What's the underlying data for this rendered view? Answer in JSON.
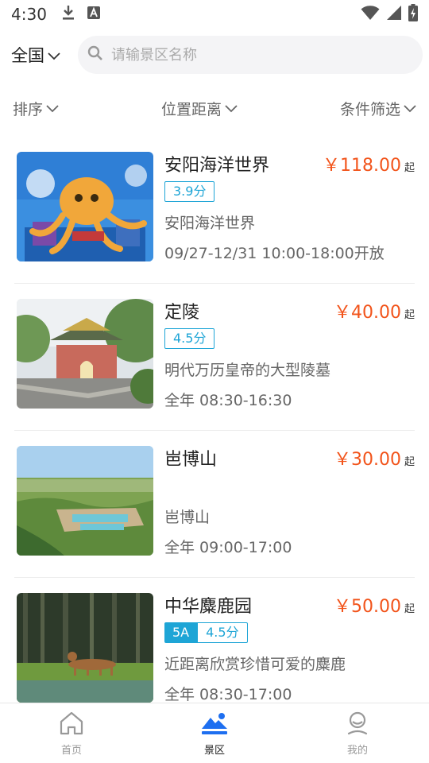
{
  "status_bar": {
    "time": "4:30"
  },
  "search": {
    "region": "全国",
    "placeholder": "请输景区名称"
  },
  "filters": [
    {
      "label": "排序"
    },
    {
      "label": "位置距离"
    },
    {
      "label": "条件筛选"
    }
  ],
  "spots": [
    {
      "title": "安阳海洋世界",
      "price": "￥118.00",
      "price_suffix": "起",
      "level": "",
      "score": "3.9分",
      "desc": "安阳海洋世界",
      "hours": "09/27-12/31 10:00-18:00开放"
    },
    {
      "title": "定陵",
      "price": "￥40.00",
      "price_suffix": "起",
      "level": "",
      "score": "4.5分",
      "desc": "明代万历皇帝的大型陵墓",
      "hours": "全年 08:30-16:30"
    },
    {
      "title": "岜博山",
      "price": "￥30.00",
      "price_suffix": "起",
      "level": "",
      "score": "",
      "desc": "岜博山",
      "hours": "全年 09:00-17:00"
    },
    {
      "title": "中华麋鹿园",
      "price": "￥50.00",
      "price_suffix": "起",
      "level": "5A",
      "score": "4.5分",
      "desc": "近距离欣赏珍惜可爱的麋鹿",
      "hours": "全年 08:30-17:00"
    }
  ],
  "bottom_nav": [
    {
      "label": "首页",
      "icon": "home-icon"
    },
    {
      "label": "景区",
      "icon": "scenic-icon"
    },
    {
      "label": "我的",
      "icon": "profile-icon"
    }
  ],
  "colors": {
    "accent": "#1ea5d6",
    "price": "#f2541b",
    "nav_active": "#1e6ff0"
  }
}
